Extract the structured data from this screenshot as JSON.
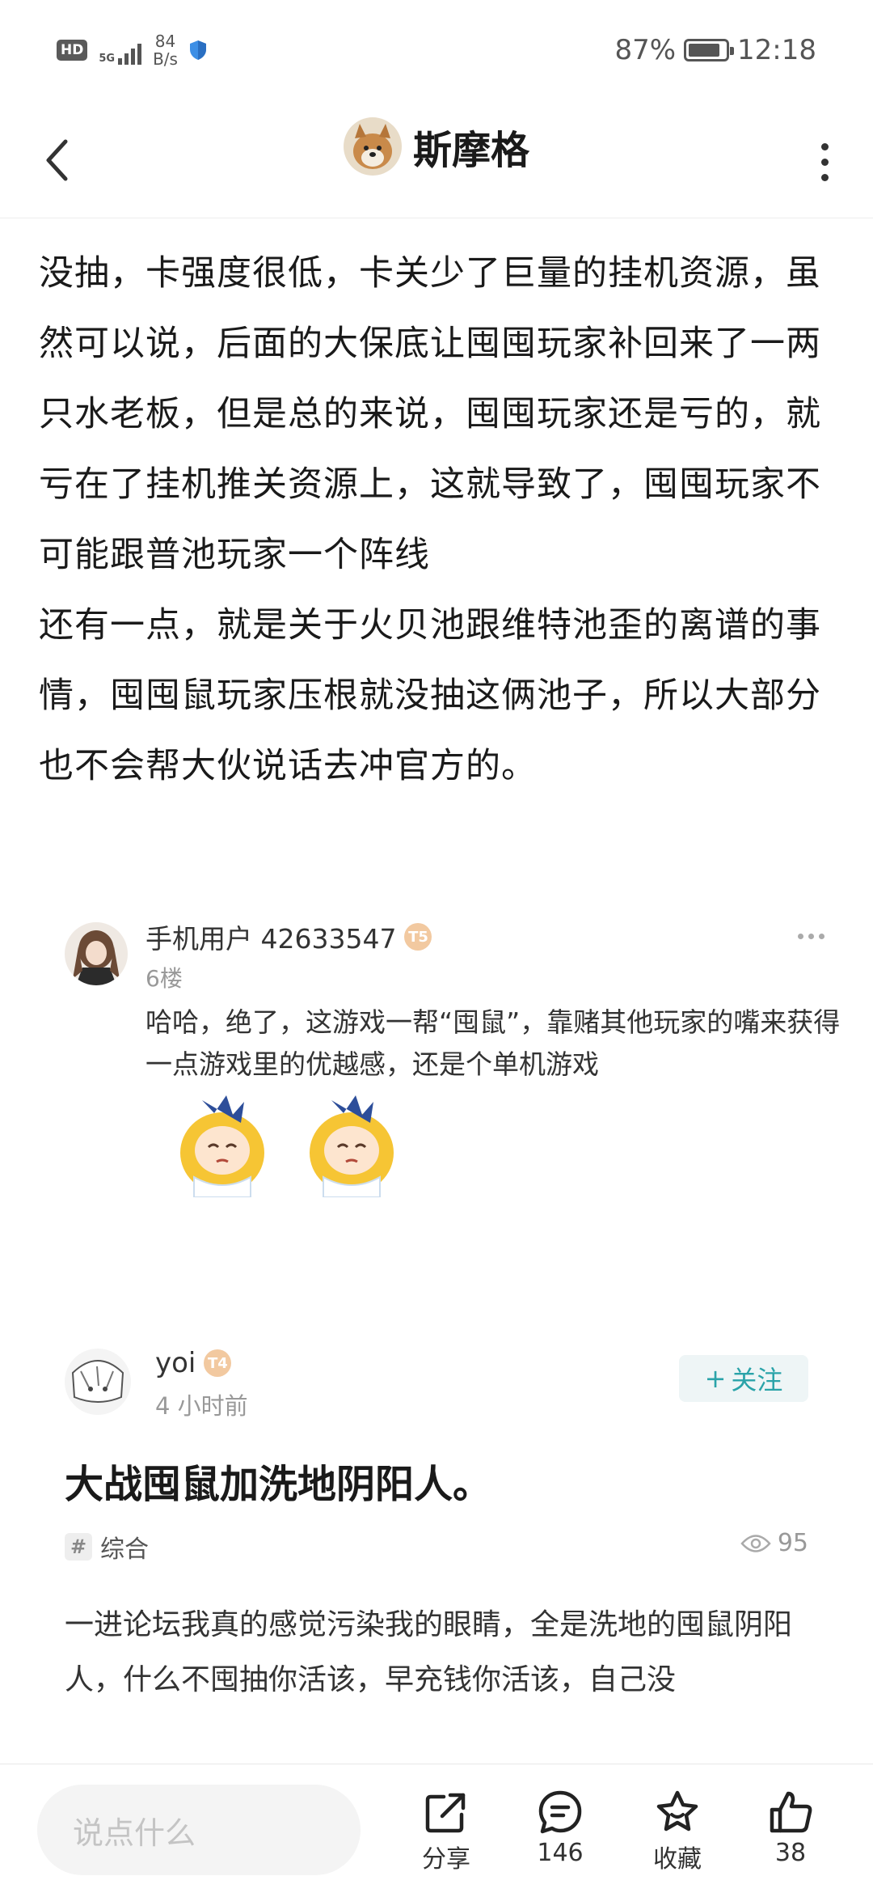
{
  "status_bar": {
    "hd": "HD",
    "network": "5G",
    "net_speed_value": "84",
    "net_speed_unit": "B/s",
    "battery": "87%",
    "battery_level": 0.87,
    "time": "12:18"
  },
  "header": {
    "title": "斯摩格",
    "back_icon": "chevron-left-icon",
    "more_icon": "more-vertical-icon"
  },
  "article": {
    "paragraphs": [
      "玩家呢，补偿了单只。并且囤囤玩家开服至今因为没抽，卡强度很低，卡关少了巨量的挂机资源，虽然可以说，后面的大保底让囤囤玩家补回来了一两只水老板，但是总的来说，囤囤玩家还是亏的，就亏在了挂机推关资源上，这就导致了，囤囤玩家不可能跟普池玩家一个阵线",
      "还有一点，就是关于火贝池跟维特池歪的离谱的事情，囤囤鼠玩家压根就没抽这俩池子，所以大部分也不会帮大伙说话去冲官方的。"
    ]
  },
  "reply": {
    "username": "手机用户 42633547",
    "level": "T5",
    "floor": "6楼",
    "text": "哈哈，绝了，这游戏一帮“囤鼠”，靠赌其他玩家的嘴来获得一点游戏里的优越感，还是个单机游戏"
  },
  "post": {
    "username": "yoi",
    "level": "T4",
    "time": "4 小时前",
    "follow_label": "关注",
    "title": "大战囤鼠加洗地阴阳人。",
    "tag": "综合",
    "tag_icon": "#",
    "views": "95",
    "body": "一进论坛我真的感觉污染我的眼睛，全是洗地的囤鼠阴阳人，什么不囤抽你活该，早充钱你活该，自己没"
  },
  "bottom_bar": {
    "input_placeholder": "说点什么",
    "share_label": "分享",
    "comments_count": "146",
    "favorite_label": "收藏",
    "likes_count": "38"
  },
  "colors": {
    "accent": "#2aa3a9",
    "badge": "#f2c9a0",
    "text": "#1a1a1a",
    "muted": "#999999"
  }
}
